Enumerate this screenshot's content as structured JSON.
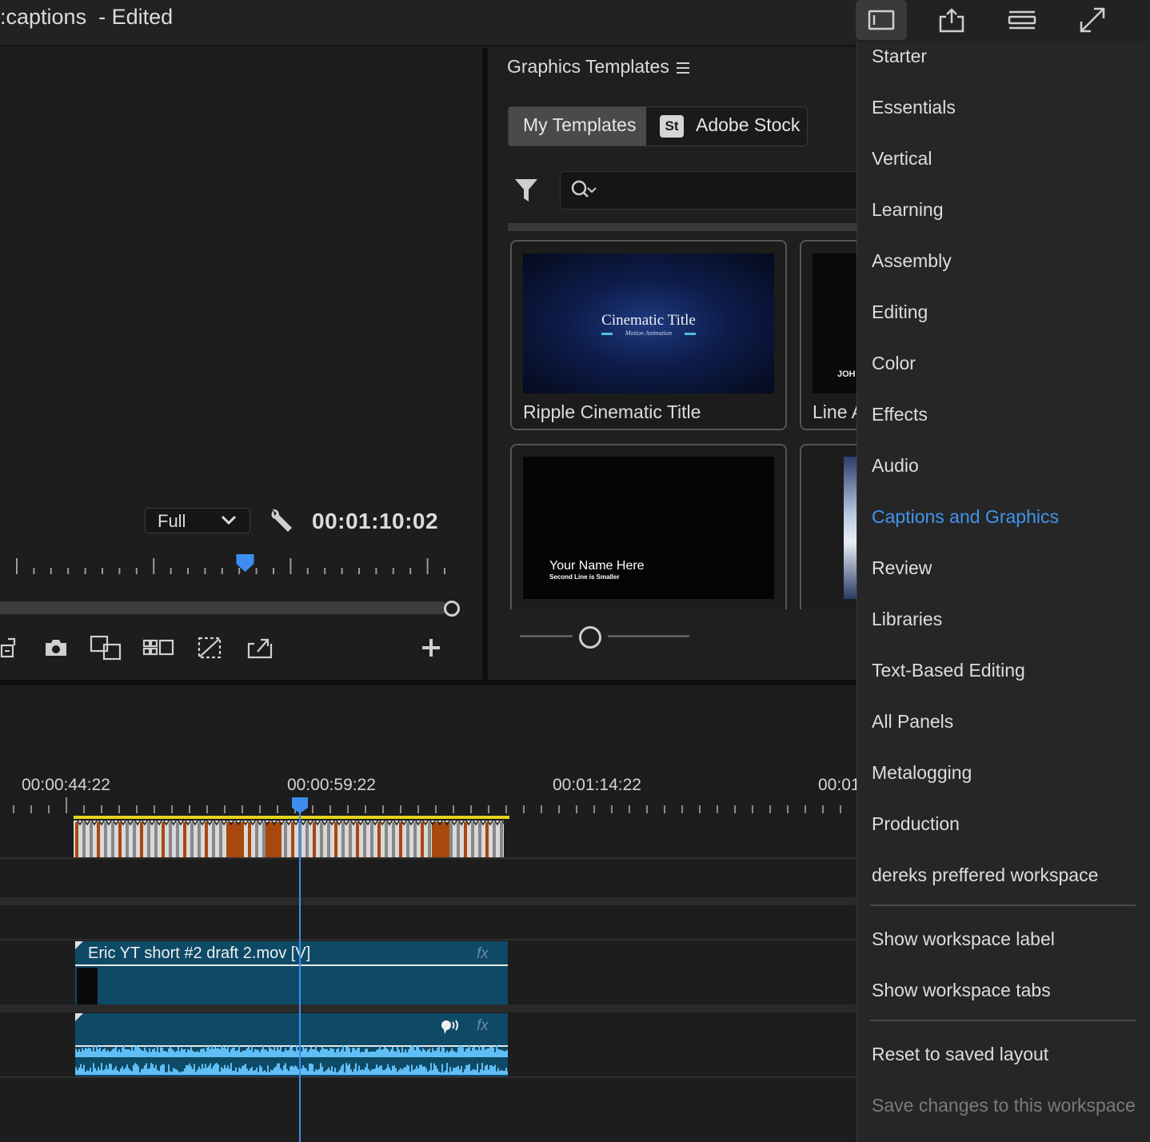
{
  "titlebar": {
    "project_name": ":captions",
    "status": "- Edited"
  },
  "top_icons": [
    "workspaces-icon",
    "share-icon",
    "quick-export-icon",
    "fullscreen-icon"
  ],
  "program_monitor": {
    "zoom_value": "Full",
    "timecode": "00:01:10:02",
    "playhead_position": 0.52
  },
  "graphics_templates": {
    "title": "Graphics Templates",
    "tabs": [
      {
        "label": "My Templates",
        "active": true
      },
      {
        "badge": "St",
        "label": "Adobe Stock",
        "active": false
      }
    ],
    "search_placeholder": "",
    "cards": [
      {
        "label": "Ripple Cinematic Title",
        "thumb_title": "Cinematic Title",
        "thumb_subtitle": "Motion Animation"
      },
      {
        "label": "Line A",
        "thumb_text": "JOH"
      },
      {
        "label": "",
        "thumb_title": "Your Name Here",
        "thumb_subtitle": "Second Line is Smaller"
      },
      {
        "label": ""
      }
    ]
  },
  "timeline": {
    "timecodes": [
      "00:00:44:22",
      "00:00:59:22",
      "00:01:14:22",
      "00:01"
    ],
    "video_clip": {
      "label": "Eric YT short #2 draft 2.mov [V]",
      "fx": "fx"
    },
    "audio_clip": {
      "fx": "fx"
    },
    "colors": {
      "clip": "#0e4a66",
      "caption_bar": "#e8d21d",
      "playhead": "#3d8ef0",
      "caption_block": "#a8480f"
    }
  },
  "workspace_menu": {
    "items": [
      {
        "label": "Starter"
      },
      {
        "label": "Essentials"
      },
      {
        "label": "Vertical"
      },
      {
        "label": "Learning"
      },
      {
        "label": "Assembly"
      },
      {
        "label": "Editing"
      },
      {
        "label": "Color"
      },
      {
        "label": "Effects"
      },
      {
        "label": "Audio"
      },
      {
        "label": "Captions and Graphics",
        "selected": true
      },
      {
        "label": "Review"
      },
      {
        "label": "Libraries"
      },
      {
        "label": "Text-Based Editing"
      },
      {
        "label": "All Panels"
      },
      {
        "label": "Metalogging"
      },
      {
        "label": "Production"
      },
      {
        "label": "dereks preffered workspace"
      }
    ],
    "options": [
      {
        "label": "Show workspace label"
      },
      {
        "label": "Show workspace tabs"
      }
    ],
    "actions": [
      {
        "label": "Reset to saved layout"
      },
      {
        "label": "Save changes to this workspace",
        "disabled": true
      }
    ],
    "accent_color": "#3f95ee"
  }
}
